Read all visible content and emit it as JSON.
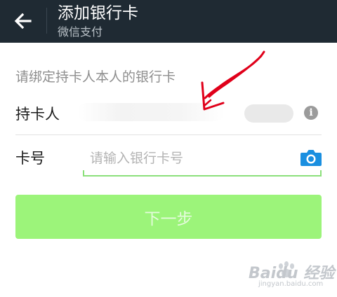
{
  "header": {
    "title": "添加银行卡",
    "subtitle": "微信支付",
    "bg_color": "#1f2a33"
  },
  "form": {
    "hint": "请绑定持卡人本人的银行卡",
    "holder_label": "持卡人",
    "card_label": "卡号",
    "card_placeholder": "请输入银行卡号",
    "card_value": ""
  },
  "next_button": {
    "label": "下一步",
    "color": "#9cf47a"
  },
  "icons": [
    "back-arrow-icon",
    "info-icon",
    "camera-icon"
  ],
  "annotation": {
    "color": "#e0001a"
  },
  "watermark": {
    "text": "Baidu 经验",
    "sub": "jingyan.baidu.com"
  }
}
